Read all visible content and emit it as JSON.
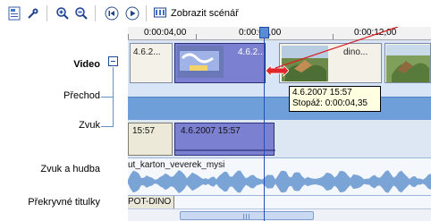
{
  "toolbar": {
    "storyboard_label": "Zobrazit scénář",
    "icons": [
      "properties-icon",
      "set-audio-levels-icon",
      "zoom-in-icon",
      "zoom-out-icon",
      "rewind-icon",
      "play-icon",
      "storyboard-icon"
    ]
  },
  "tracks": {
    "video": "Video",
    "transition": "Přechod",
    "audio": "Zvuk",
    "music": "Zvuk a hudba",
    "titles": "Překryvné titulky"
  },
  "ruler": {
    "labels": [
      "0:00:04,00",
      "0:00:08,00",
      "0:00:12,00"
    ]
  },
  "video_clips": [
    {
      "label": "4.6.2..."
    },
    {
      "label": "4.6.2..."
    },
    {
      "label": "dino..."
    }
  ],
  "audio_clips": [
    {
      "label": "15:57"
    },
    {
      "label": "4.6.2007 15:57"
    }
  ],
  "music_clip": "ut_karton_veverek_mysi",
  "title_clip": "POT-DINO",
  "tooltip": {
    "line1": "4.6.2007 15:57",
    "line2": "Stopáž:  0:00:04,35"
  },
  "colors": {
    "accent": "#2150b8",
    "transition_track": "#6f9fd9",
    "selected_audio": "#7c80d0",
    "tooltip_bg": "#ffffe1",
    "trim_arrow": "#e0262a"
  }
}
